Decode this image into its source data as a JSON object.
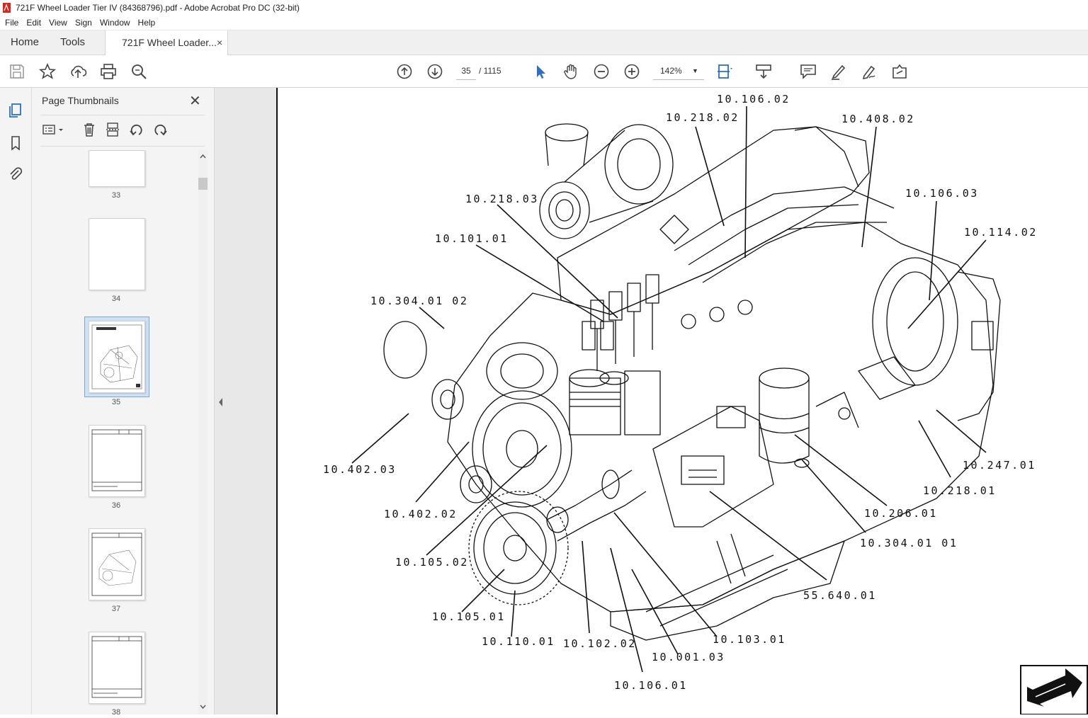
{
  "window": {
    "title": "721F Wheel Loader Tier IV (84368796).pdf - Adobe Acrobat Pro DC (32-bit)"
  },
  "menu": [
    "File",
    "Edit",
    "View",
    "Sign",
    "Window",
    "Help"
  ],
  "tabs": {
    "home": "Home",
    "tools": "Tools",
    "doc": "721F Wheel Loader...",
    "doc_close": "×"
  },
  "toolbar": {
    "page_current": "35",
    "page_total": "/ 1115",
    "zoom": "142%"
  },
  "panel": {
    "title": "Page Thumbnails",
    "close": "✕",
    "thumbnails": [
      {
        "number": "33",
        "kind": "blank"
      },
      {
        "number": "34",
        "kind": "blank"
      },
      {
        "number": "35",
        "kind": "engine",
        "selected": true
      },
      {
        "number": "36",
        "kind": "table"
      },
      {
        "number": "37",
        "kind": "engine"
      },
      {
        "number": "38",
        "kind": "table"
      }
    ]
  },
  "diagram": {
    "callouts": [
      "10.106.02",
      "10.218.02",
      "10.408.02",
      "10.218.03",
      "10.106.03",
      "10.114.02",
      "10.101.01",
      "10.304.01 02",
      "10.402.03",
      "10.402.02",
      "10.105.02",
      "10.105.01",
      "10.110.01",
      "10.102.02",
      "10.106.01",
      "10.001.03",
      "10.103.01",
      "55.640.01",
      "10.304.01 01",
      "10.206.01",
      "10.218.01",
      "10.247.01"
    ]
  },
  "colors": {
    "accent": "#2f6fbd",
    "pdf_red": "#d7261e",
    "selection": "#cfe1f5"
  }
}
